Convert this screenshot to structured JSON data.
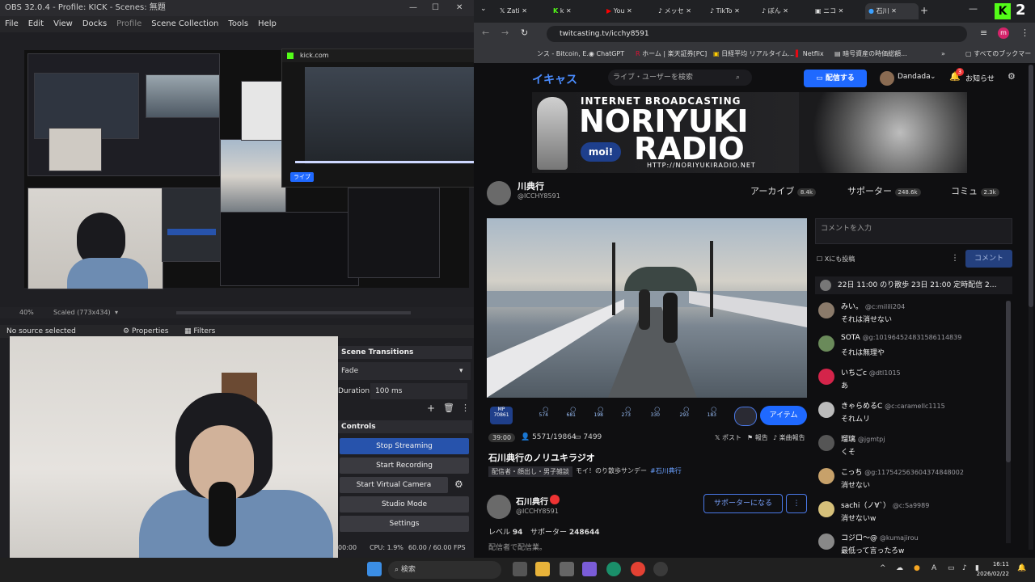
{
  "obs": {
    "title": "OBS 32.0.4 - Profile: KICK - Scenes: 無題",
    "menu": [
      "File",
      "Edit",
      "View",
      "Docks",
      "Profile",
      "Scene Collection",
      "Tools",
      "Help"
    ],
    "zoom": "40%",
    "scaled": "Scaled (773x434)",
    "no_source": "No source selected",
    "properties": "Properties",
    "filters": "Filters",
    "transitions_head": "Scene Transitions",
    "transition": "Fade",
    "duration_label": "Duration",
    "duration_value": "100 ms",
    "controls_head": "Controls",
    "btn_stop_streaming": "Stop Streaming",
    "btn_start_recording": "Start Recording",
    "btn_start_virtual": "Start Virtual Camera",
    "btn_studio": "Studio Mode",
    "btn_settings": "Settings",
    "status_time": "00:00",
    "status_cpu": "CPU: 1.9%",
    "status_fps": "60.00 / 60.00 FPS"
  },
  "kick_popup": {
    "title": "kick.com",
    "live_badge": "ライブ",
    "progress_fraction": 0.82
  },
  "browser": {
    "tabs": [
      "Zati",
      "k",
      "You",
      "メッセ",
      "TikTo",
      "ぼん",
      "ニコ",
      "石川"
    ],
    "url": "twitcasting.tv/icchy8591",
    "bookmarks": [
      "ンス - Bitcoin, E...",
      "ChatGPT",
      "ホーム | 楽天証券[PC]",
      "日経平均 リアルタイム...",
      "Netflix",
      "暗号資産の時価総額..."
    ],
    "bookmarks_folder": "すべてのブックマーク"
  },
  "site": {
    "logo": "イキャス",
    "search_placeholder": "ライブ・ユーザーを検索",
    "broadcast_btn": "配信する",
    "username": "Dandada",
    "notice": "お知らせ",
    "notice_count": "3",
    "banner_line1": "INTERNET BROADCASTING",
    "banner_line2": "NORIYUKI",
    "banner_line3": "RADIO",
    "banner_moi": "moi!",
    "banner_url": "HTTP://NORIYUKIRADIO.NET",
    "channel_name": "川典行",
    "channel_id": "@ICCHY8591",
    "nav_archive": "アーカイブ",
    "nav_archive_count": "8.4k",
    "nav_supporter": "サポーター",
    "nav_supporter_count": "248.6k",
    "nav_community": "コミュ",
    "nav_community_count": "2.3k",
    "comment_placeholder": "コメントを入力",
    "post_also": "Xにも投稿",
    "comment_btn": "コメント",
    "pinned": "22日 11:00 のり散歩 23日 21:00 定時配信 2…",
    "item_counts": [
      "70861",
      "574",
      "681",
      "198",
      "273",
      "330",
      "293",
      "183"
    ],
    "item_btn": "アイテム",
    "timer": "39:00",
    "viewers": "5571/19864",
    "comment_count": "7499",
    "x_post": "ポスト",
    "report": "報告",
    "music": "楽曲報告",
    "live_title": "石川典行のノリユキラジオ",
    "tag1": "配信者・顔出し・男子雑談",
    "tag2": "モイ！のり散歩サンデー",
    "tag3": "#石川典行",
    "owner_name": "石川典行",
    "owner_id": "@ICCHY8591",
    "supporter_btn": "サポーターになる",
    "level_label": "レベル",
    "level": "94",
    "supporter_label": "サポーター",
    "supporter_count": "248644",
    "description": "配信者で配信業。"
  },
  "comments": [
    {
      "name": "みい。",
      "id": "@c:milili204",
      "text": "それは消せない",
      "color": "#8a7a6a"
    },
    {
      "name": "SOTA",
      "id": "@g:101964524831586114839",
      "text": "それは無理や",
      "color": "#6a8a5a"
    },
    {
      "name": "いちごc",
      "id": "@dtl1015",
      "text": "あ",
      "color": "#d4244a"
    },
    {
      "name": "きゃらめるC",
      "id": "@c:caramellc1115",
      "text": "それムリ",
      "color": "#bbbbbb"
    },
    {
      "name": "瑠璃",
      "id": "@jgmtpj",
      "text": "くそ",
      "color": "#555555"
    },
    {
      "name": "こっち",
      "id": "@g:117542563604374848002",
      "text": "消せない",
      "color": "#c7a16a"
    },
    {
      "name": "sachi（ノ∀`）",
      "id": "@c:Sa9989",
      "text": "消せないw",
      "color": "#d6c07a"
    },
    {
      "name": "コジロ〜@",
      "id": "@kumajirou",
      "text": "最低って言ったろw",
      "color": "#888888"
    }
  ],
  "taskbar": {
    "search": "検索",
    "time": "16:11",
    "date": "2026/02/22"
  }
}
